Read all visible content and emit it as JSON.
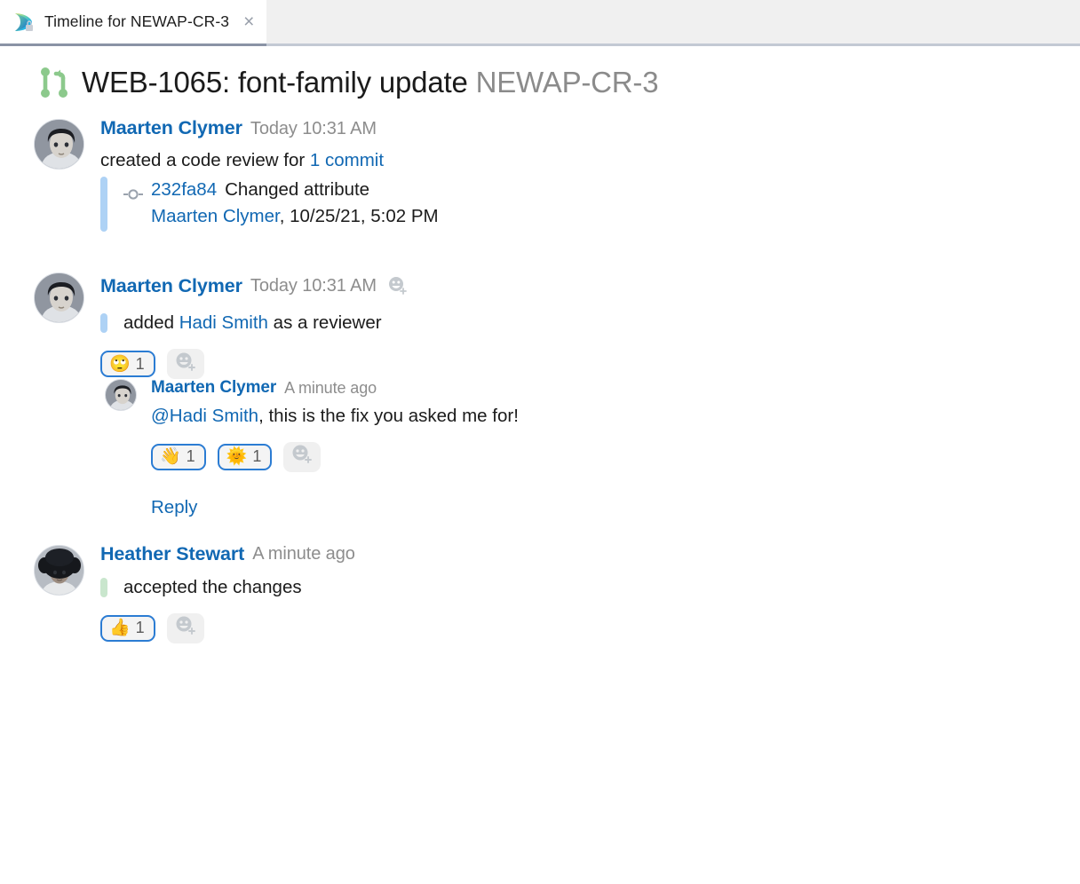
{
  "tab": {
    "title": "Timeline for NEWAP-CR-3",
    "close_label": "×",
    "icon": "app-logo-lock-icon"
  },
  "header": {
    "icon": "merge-request-icon",
    "summary": "WEB-1065: font-family update",
    "issue_key": "NEWAP-CR-3"
  },
  "colors": {
    "link": "#1168b3",
    "muted": "#8d8d8d",
    "bar_blue": "#aed2f5",
    "bar_green": "#c9e6cd",
    "pill_border": "#2b7cd3",
    "tab_bar": "#f0f0f0"
  },
  "timeline": [
    {
      "author": "Maarten Clymer",
      "timestamp": "Today 10:31 AM",
      "action_prefix": "created a code review for ",
      "action_link": "1 commit",
      "commit": {
        "hash": "232fa84",
        "message": "Changed attribute",
        "author": "Maarten Clymer",
        "date": ", 10/25/21, 5:02 PM"
      }
    },
    {
      "author": "Maarten Clymer",
      "timestamp": "Today 10:31 AM",
      "action_prefix": "added ",
      "action_link": "Hadi Smith",
      "action_suffix": " as a reviewer",
      "reactions": [
        {
          "emoji": "🙄",
          "name": "rolling-eyes-reaction",
          "count": "1"
        }
      ],
      "add_reaction_label": "add-reaction"
    },
    {
      "author": "Maarten Clymer",
      "timestamp": "A minute ago",
      "mention": "@Hadi Smith",
      "comment_rest": ", this is the fix you asked me for!",
      "reactions": [
        {
          "emoji": "👋",
          "name": "waving-hand-reaction",
          "count": "1"
        },
        {
          "emoji": "🌞",
          "name": "sun-with-face-reaction",
          "count": "1"
        }
      ],
      "reply_label": "Reply"
    },
    {
      "author": "Heather Stewart",
      "timestamp": "A minute ago",
      "action_text": "accepted the changes",
      "reactions": [
        {
          "emoji": "👍",
          "name": "thumbs-up-reaction",
          "count": "1"
        }
      ]
    }
  ]
}
